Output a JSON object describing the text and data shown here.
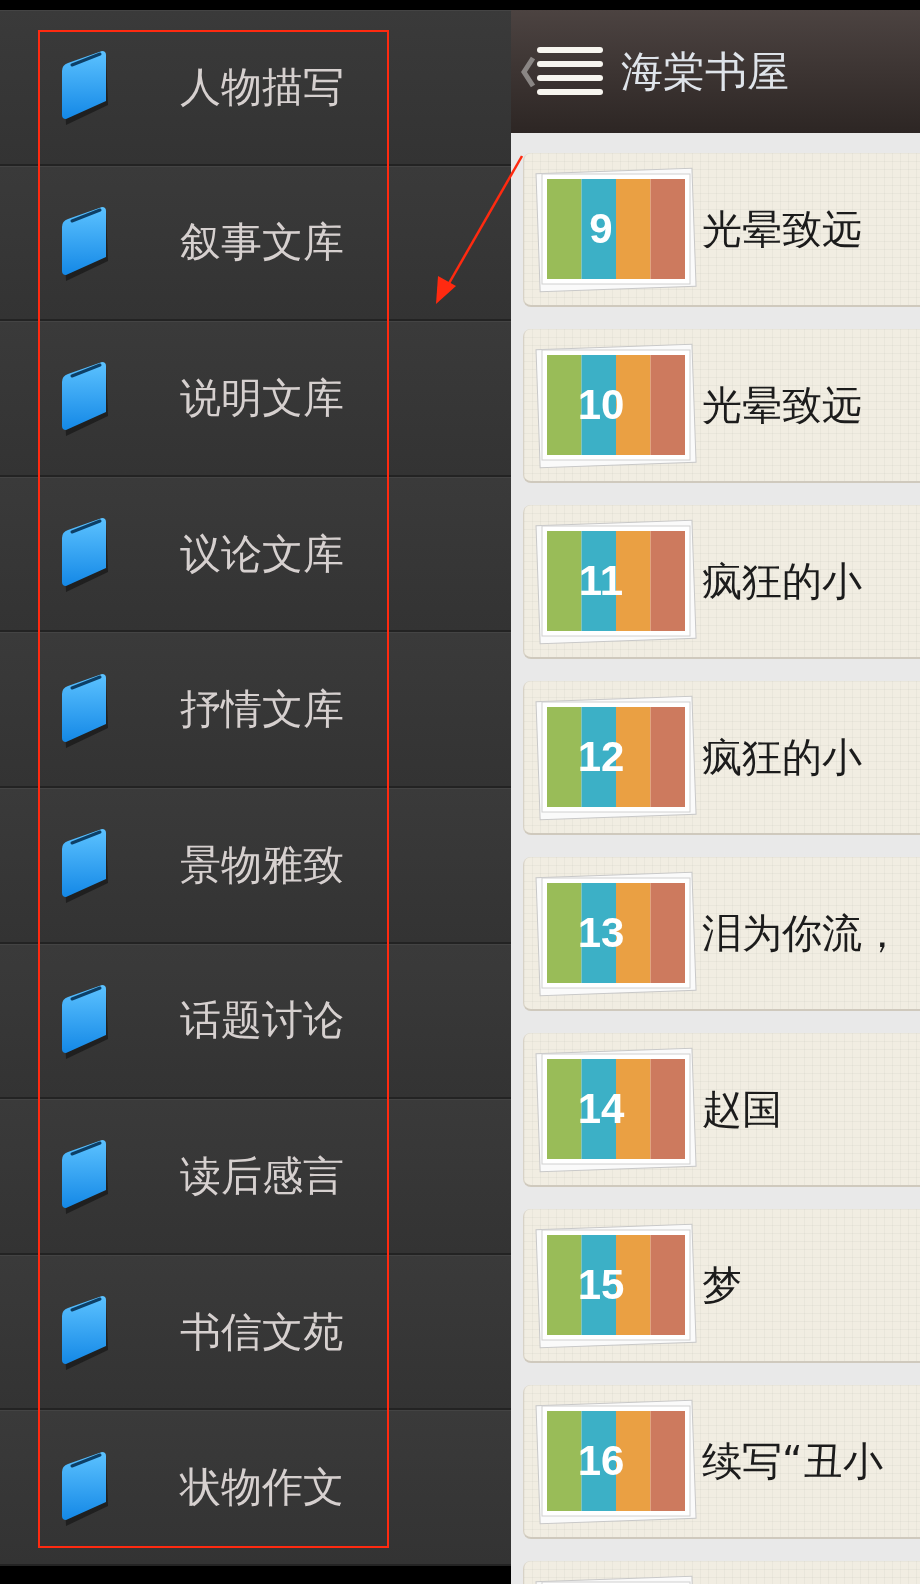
{
  "sidebar": {
    "items": [
      {
        "label": "人物描写"
      },
      {
        "label": "叙事文库"
      },
      {
        "label": "说明文库"
      },
      {
        "label": "议论文库"
      },
      {
        "label": "抒情文库"
      },
      {
        "label": "景物雅致"
      },
      {
        "label": "话题讨论"
      },
      {
        "label": "读后感言"
      },
      {
        "label": "书信文苑"
      },
      {
        "label": "状物作文"
      }
    ]
  },
  "header": {
    "title": "海棠书屋"
  },
  "list": {
    "items": [
      {
        "number": "9",
        "title": "光晕致远"
      },
      {
        "number": "10",
        "title": "光晕致远"
      },
      {
        "number": "11",
        "title": "疯狂的小"
      },
      {
        "number": "12",
        "title": "疯狂的小"
      },
      {
        "number": "13",
        "title": "泪为你流，"
      },
      {
        "number": "14",
        "title": "赵国"
      },
      {
        "number": "15",
        "title": "梦"
      },
      {
        "number": "16",
        "title": "续写“丑小"
      }
    ]
  }
}
